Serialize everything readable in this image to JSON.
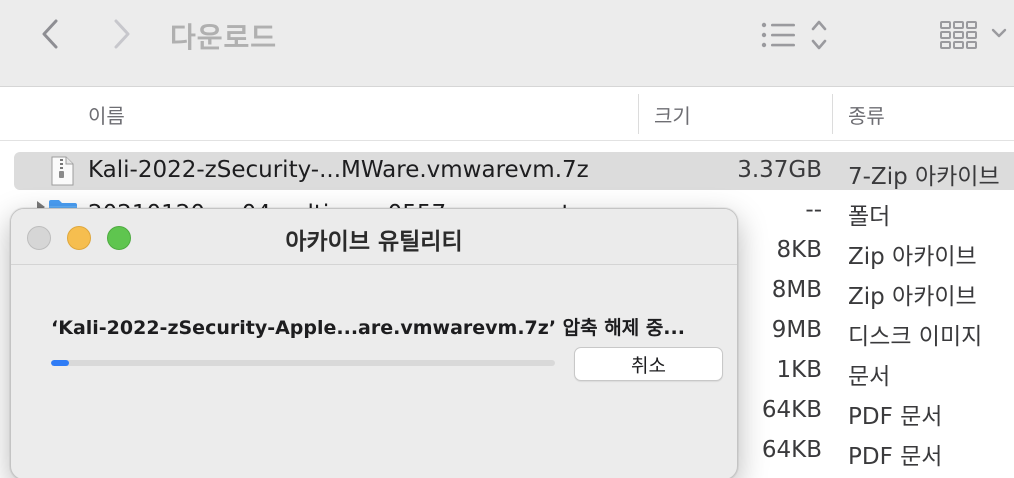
{
  "toolbar": {
    "folder_title": "다운로드",
    "back_icon": "chevron-left-icon",
    "forward_icon": "chevron-right-icon",
    "list_view_icon": "list-view-icon",
    "sort_icon": "updown-chevron-icon",
    "grid_view_icon": "grid-view-icon"
  },
  "columns": {
    "name": "이름",
    "size": "크기",
    "kind": "종류"
  },
  "files": [
    {
      "name": "Kali-2022-zSecurity-...MWare.vmwarevm.7z",
      "size": "3.37GB",
      "kind": "7-Zip 아카이브",
      "selected": true,
      "icon": "archive-file-icon"
    },
    {
      "name": "",
      "size": "--",
      "kind": "폴더",
      "icon": "folder-icon"
    },
    {
      "name": "",
      "size": "8KB",
      "kind": "Zip 아카이브"
    },
    {
      "name": "",
      "size": "8MB",
      "kind": "Zip 아카이브"
    },
    {
      "name": "",
      "size": "9MB",
      "kind": "디스크 이미지"
    },
    {
      "name": "",
      "size": "1KB",
      "kind": "문서"
    },
    {
      "name": "",
      "size": "64KB",
      "kind": "PDF 문서"
    },
    {
      "name": "",
      "size": "64KB",
      "kind": "PDF 문서"
    }
  ],
  "partial_row_text": "20210120 ... 04 ... ltimon 0557 ... aaa ... t",
  "dialog": {
    "title": "아카이브 유틸리티",
    "status": "‘Kali-2022-zSecurity-Apple...are.vmwarevm.7z’ 압축 해제 중...",
    "progress": 0.035,
    "cancel_label": "취소",
    "accent_color": "#2f7cf6"
  }
}
